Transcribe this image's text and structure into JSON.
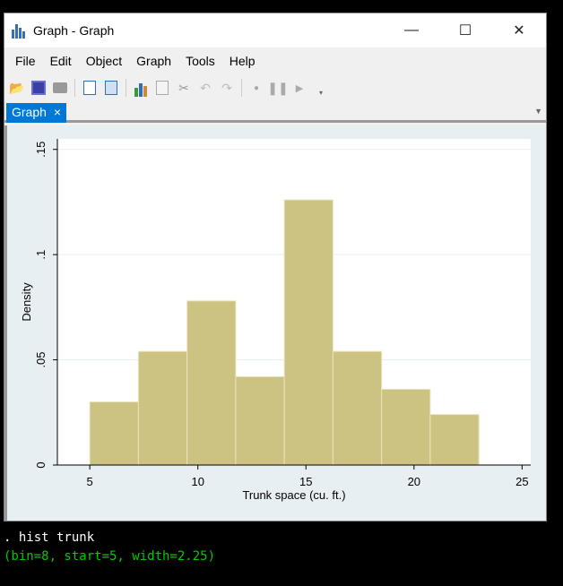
{
  "window": {
    "title": "Graph - Graph",
    "minimize": "—",
    "maximize": "☐",
    "close": "✕"
  },
  "menu": [
    "File",
    "Edit",
    "Object",
    "Graph",
    "Tools",
    "Help"
  ],
  "toolbar": [
    "open-icon",
    "save-icon",
    "print-icon",
    "copy-icon",
    "copy-export-icon",
    "graph-editor-icon",
    "rename-icon",
    "pointer-icon",
    "undo-icon",
    "redo-icon",
    "record-icon",
    "pause-icon",
    "play-icon"
  ],
  "tab": {
    "label": "Graph",
    "close": "×"
  },
  "colors": {
    "bar": "#ccc383",
    "bar_edge": "#e8e3c0",
    "accent": "#0078d7"
  },
  "chart_data": {
    "type": "bar",
    "title": "",
    "xlabel": "Trunk space (cu. ft.)",
    "ylabel": "Density",
    "bin_start": 5,
    "bin_width": 2.25,
    "values": [
      0.03,
      0.054,
      0.078,
      0.042,
      0.126,
      0.054,
      0.036,
      0.024
    ],
    "xlim": [
      3.5,
      25.4
    ],
    "ylim": [
      0,
      0.155
    ],
    "xticks": [
      "5",
      "10",
      "15",
      "20",
      "25"
    ],
    "yticks": [
      "0",
      ".05",
      ".1",
      ".15"
    ],
    "grid": true
  },
  "console": {
    "command": ". hist trunk",
    "output": "(bin=8, start=5, width=2.25)"
  }
}
